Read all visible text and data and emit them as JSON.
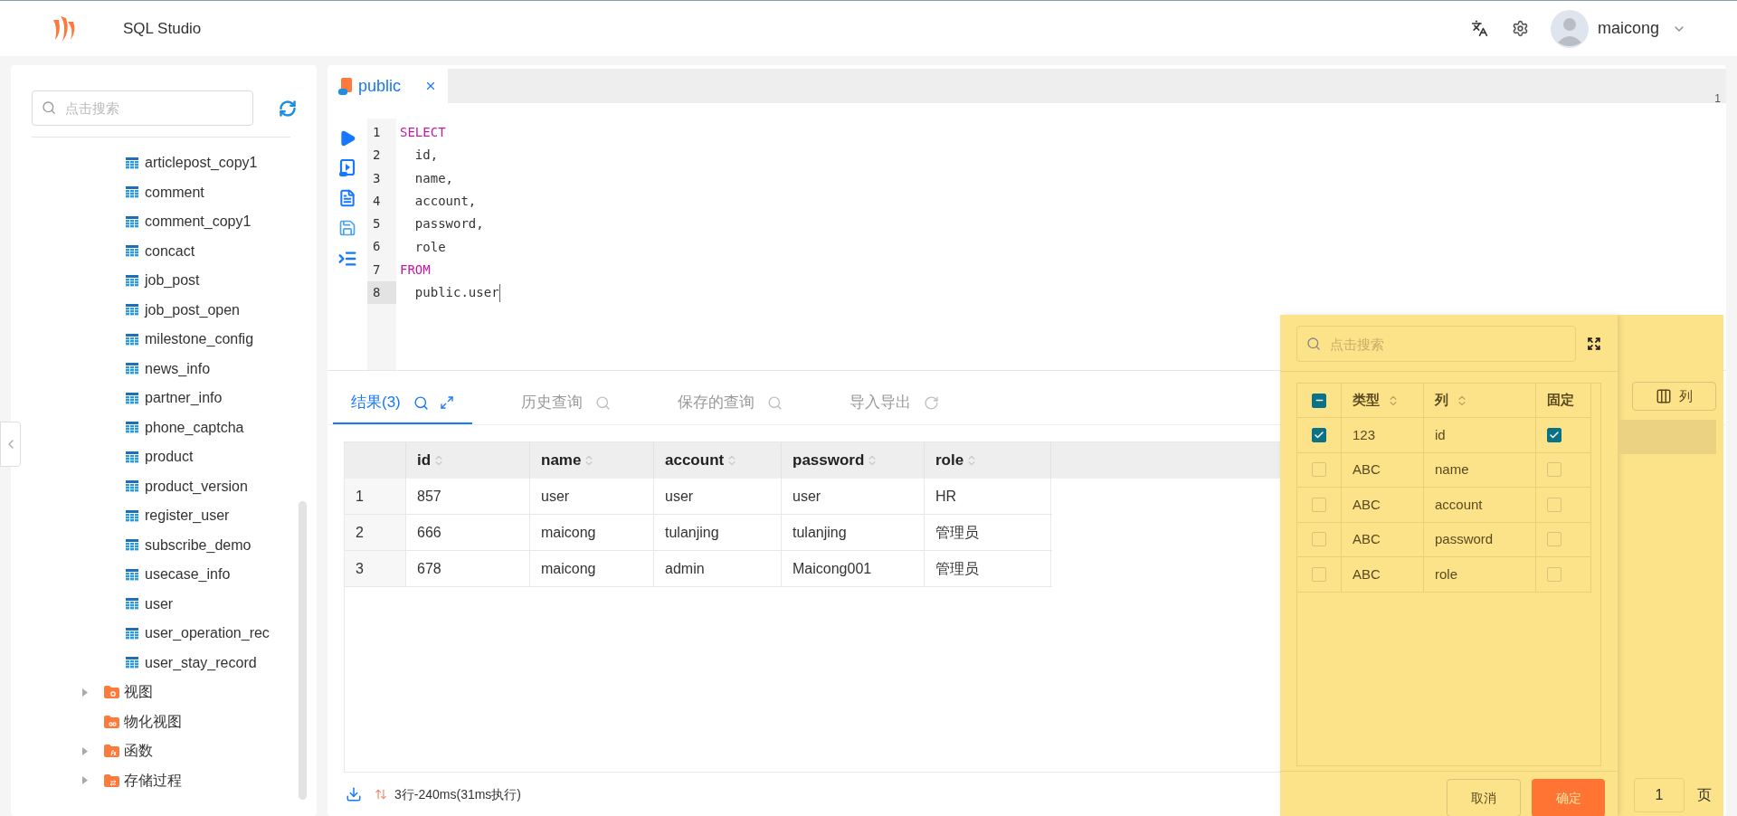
{
  "header": {
    "title": "SQL Studio",
    "user": "maicong"
  },
  "sidebar": {
    "search_placeholder": "点击搜索",
    "tables": [
      "articlepost_copy1",
      "comment",
      "comment_copy1",
      "concact",
      "job_post",
      "job_post_open",
      "milestone_config",
      "news_info",
      "partner_info",
      "phone_captcha",
      "product",
      "product_version",
      "register_user",
      "subscribe_demo",
      "usecase_info",
      "user",
      "user_operation_rec",
      "user_stay_record"
    ],
    "folders": [
      {
        "label": "视图",
        "expandable": true,
        "kind": "view"
      },
      {
        "label": "物化视图",
        "expandable": false,
        "kind": "matview"
      },
      {
        "label": "函数",
        "expandable": true,
        "kind": "function"
      },
      {
        "label": "存储过程",
        "expandable": true,
        "kind": "procedure"
      }
    ]
  },
  "editor": {
    "tab": {
      "label": "public"
    },
    "corner_text": "1",
    "lines": [
      {
        "number": "1",
        "text": "SELECT",
        "kind": "keyword",
        "current": false
      },
      {
        "number": "2",
        "text": "  id,",
        "kind": "plain",
        "current": false
      },
      {
        "number": "3",
        "text": "  name,",
        "kind": "plain",
        "current": false
      },
      {
        "number": "4",
        "text": "  account,",
        "kind": "plain",
        "current": false
      },
      {
        "number": "5",
        "text": "  password,",
        "kind": "plain",
        "current": false
      },
      {
        "number": "6",
        "text": "  role",
        "kind": "plain",
        "current": false
      },
      {
        "number": "7",
        "text": "FROM",
        "kind": "keyword",
        "current": false
      },
      {
        "number": "8",
        "text": "  public.user",
        "kind": "plain",
        "current": true
      }
    ]
  },
  "result_tabs": [
    {
      "label": "结果(3)",
      "selected": true,
      "kind": "result"
    },
    {
      "label": "历史查询",
      "selected": false,
      "kind": "history"
    },
    {
      "label": "保存的查询",
      "selected": false,
      "kind": "saved"
    },
    {
      "label": "导入导出",
      "selected": false,
      "kind": "io"
    }
  ],
  "table": {
    "columns": [
      "id",
      "name",
      "account",
      "password",
      "role"
    ],
    "rows": [
      {
        "index": "1",
        "cells": [
          "857",
          "user",
          "user",
          "user",
          "HR"
        ]
      },
      {
        "index": "2",
        "cells": [
          "666",
          "maicong",
          "tulanjing",
          "tulanjing",
          "管理员"
        ]
      },
      {
        "index": "3",
        "cells": [
          "678",
          "maicong",
          "admin",
          "Maicong001",
          "管理员"
        ]
      }
    ]
  },
  "status_bar": {
    "summary": "3行-240ms(31ms执行)"
  },
  "columns_button": "列",
  "pager": {
    "page": "1",
    "suffix": "页"
  },
  "column_picker": {
    "search_placeholder": "点击搜索",
    "select_all": {
      "partial": true
    },
    "headers": [
      "类型",
      "列",
      "固定"
    ],
    "rows": [
      {
        "type": "123",
        "column": "id",
        "checked": true,
        "pinned": true
      },
      {
        "type": "ABC",
        "column": "name",
        "checked": false,
        "pinned": false
      },
      {
        "type": "ABC",
        "column": "account",
        "checked": false,
        "pinned": false
      },
      {
        "type": "ABC",
        "column": "password",
        "checked": false,
        "pinned": false
      },
      {
        "type": "ABC",
        "column": "role",
        "checked": false,
        "pinned": false
      }
    ],
    "cancel": "取消",
    "confirm": "确定"
  }
}
